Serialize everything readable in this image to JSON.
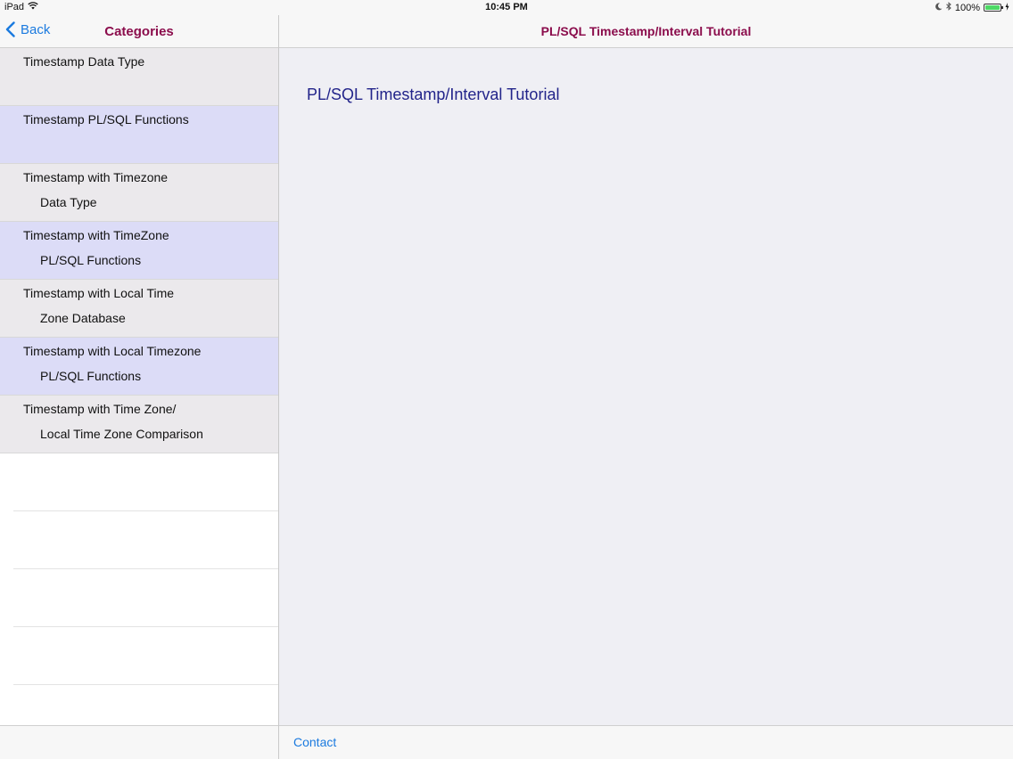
{
  "status_bar": {
    "device": "iPad",
    "time": "10:45 PM",
    "battery": "100%",
    "battery_level": 1.0
  },
  "sidebar": {
    "back_label": "Back",
    "title": "Categories",
    "items": [
      {
        "line1": "Timestamp Data Type",
        "line2": ""
      },
      {
        "line1": "Timestamp PL/SQL Functions",
        "line2": ""
      },
      {
        "line1": "Timestamp with Timezone",
        "line2": "Data Type"
      },
      {
        "line1": "Timestamp with TimeZone",
        "line2": "PL/SQL Functions"
      },
      {
        "line1": "Timestamp with Local Time",
        "line2": "Zone Database"
      },
      {
        "line1": "Timestamp with Local Timezone",
        "line2": "PL/SQL Functions"
      },
      {
        "line1": "Timestamp with Time Zone/",
        "line2": "Local Time Zone Comparison"
      }
    ]
  },
  "main": {
    "nav_title": "PL/SQL Timestamp/Interval Tutorial",
    "heading": "PL/SQL Timestamp/Interval Tutorial"
  },
  "toolbar": {
    "contact_label": "Contact"
  },
  "colors": {
    "accent_blue": "#1a7adf",
    "title_maroon": "#8b0d4c",
    "heading_navy": "#22248a",
    "row_odd": "#ebe9ec",
    "row_even": "#dcdcf7"
  }
}
